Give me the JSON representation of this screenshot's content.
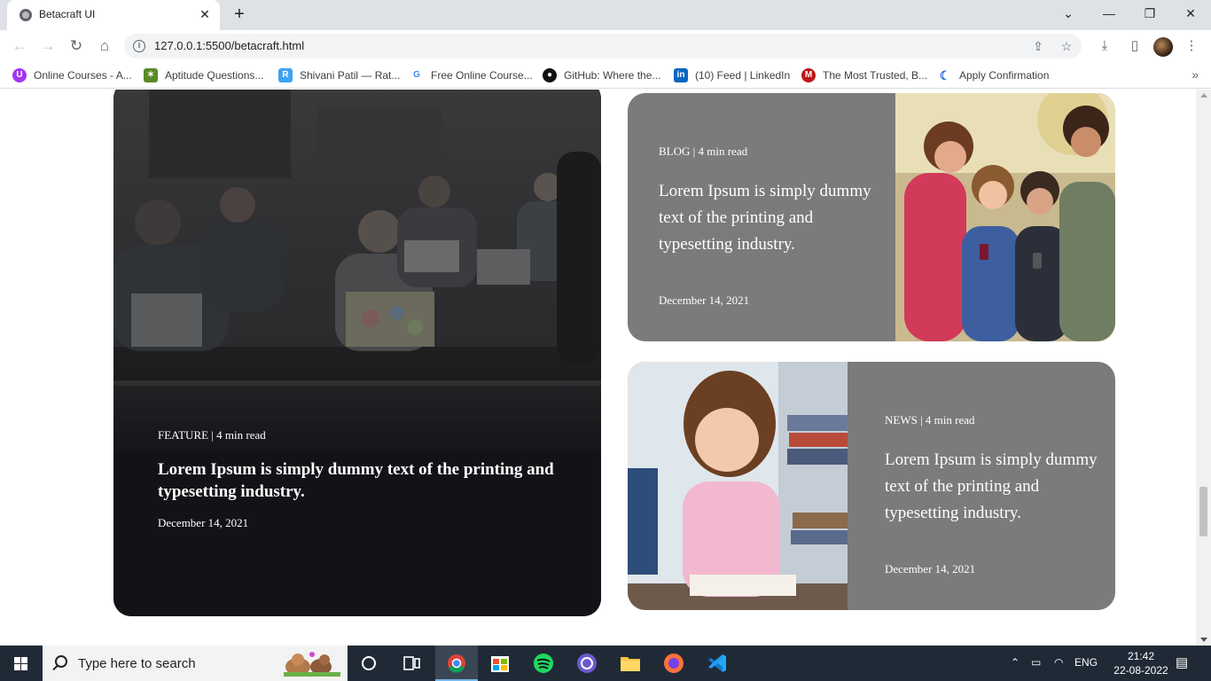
{
  "browser": {
    "tab_title": "Betacraft UI",
    "tab_close": "✕",
    "new_tab": "+",
    "url": "127.0.0.1:5500/betacraft.html",
    "window_controls": [
      "⌄",
      "—",
      "❐",
      "✕"
    ]
  },
  "bookmarks": [
    {
      "label": "Online Courses - A...",
      "icon": "udemy-icon",
      "color": "#a435f0"
    },
    {
      "label": "Aptitude Questions...",
      "icon": "indiabix-icon",
      "color": "#5a8a2a"
    },
    {
      "label": "Shivani Patil — Rat...",
      "icon": "ratings-icon",
      "color": "#3ea3f3"
    },
    {
      "label": "Free Online Course...",
      "icon": "google-icon",
      "color": "#4285f4"
    },
    {
      "label": "GitHub: Where the...",
      "icon": "github-icon",
      "color": "#111111"
    },
    {
      "label": "(10) Feed | LinkedIn",
      "icon": "linkedin-icon",
      "color": "#0a66c2"
    },
    {
      "label": "The Most Trusted, B...",
      "icon": "mcafee-icon",
      "color": "#c01818"
    },
    {
      "label": "Apply Confirmation",
      "icon": "confirmation-icon",
      "color": "#2d6ae3"
    }
  ],
  "bookmarks_more": "»",
  "feature": {
    "meta": "FEATURE | 4 min read",
    "headline": "Lorem Ipsum is simply dummy text of the printing and typesetting industry.",
    "date": "December 14, 2021"
  },
  "blog": {
    "meta": "BLOG | 4 min read",
    "headline": "Lorem Ipsum is simply dummy text of the printing and typesetting industry.",
    "date": "December 14, 2021"
  },
  "news": {
    "meta": "NEWS | 4 min read",
    "headline": "Lorem Ipsum is simply dummy text of the printing and typesetting industry.",
    "date": "December 14, 2021"
  },
  "taskbar": {
    "search_placeholder": "Type here to search",
    "language": "ENG",
    "time": "21:42",
    "date": "22-08-2022"
  },
  "colors": {
    "card_gray": "#7b7b7b",
    "feature_dark": "#121217",
    "taskbar": "#202a36"
  }
}
